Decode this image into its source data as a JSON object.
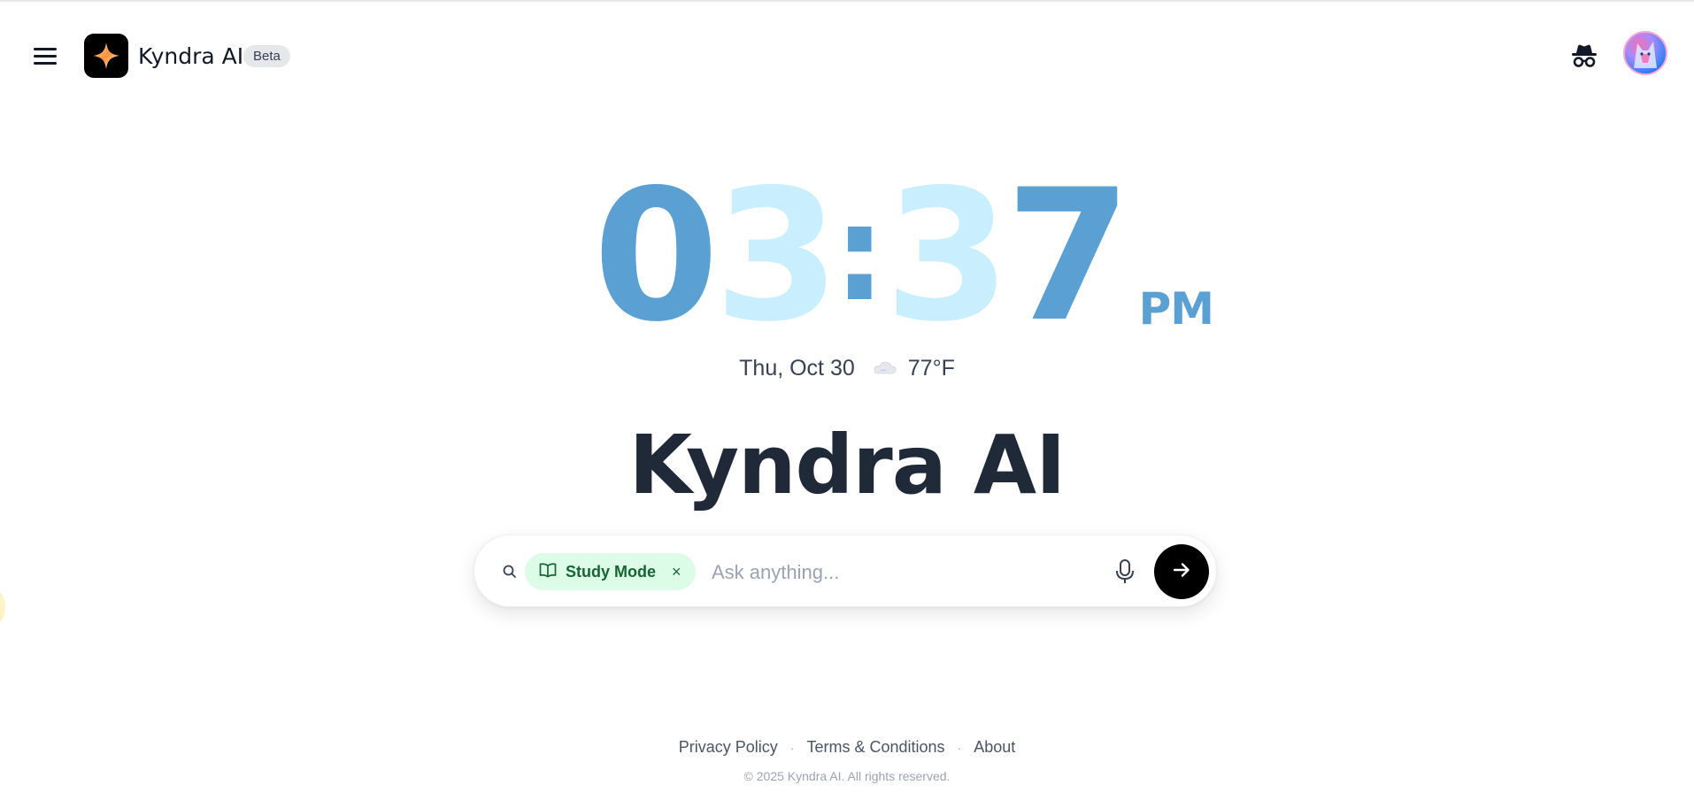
{
  "header": {
    "brand_name": "Kyndra AI",
    "badge": "Beta"
  },
  "clock": {
    "hour_tens": "0",
    "hour_ones": "3",
    "colon": ":",
    "minute_tens": "3",
    "minute_ones": "7",
    "ampm": "PM"
  },
  "date_weather": {
    "date": "Thu, Oct 30",
    "weather_icon": "cloud-icon",
    "temperature": "77°F"
  },
  "main": {
    "title": "Kyndra AI"
  },
  "search": {
    "mode_chip": "Study Mode",
    "chip_close": "×",
    "placeholder": "Ask anything...",
    "value": ""
  },
  "footer": {
    "links": [
      "Privacy Policy",
      "Terms & Conditions",
      "About"
    ],
    "separator": "·",
    "copyright": "© 2025 Kyndra AI. All rights reserved."
  },
  "colors": {
    "clock_dark": "#5aa0d3",
    "clock_light": "#c9efff",
    "chip_bg": "#dcfce7",
    "chip_text": "#166534",
    "send_bg": "#000000"
  }
}
